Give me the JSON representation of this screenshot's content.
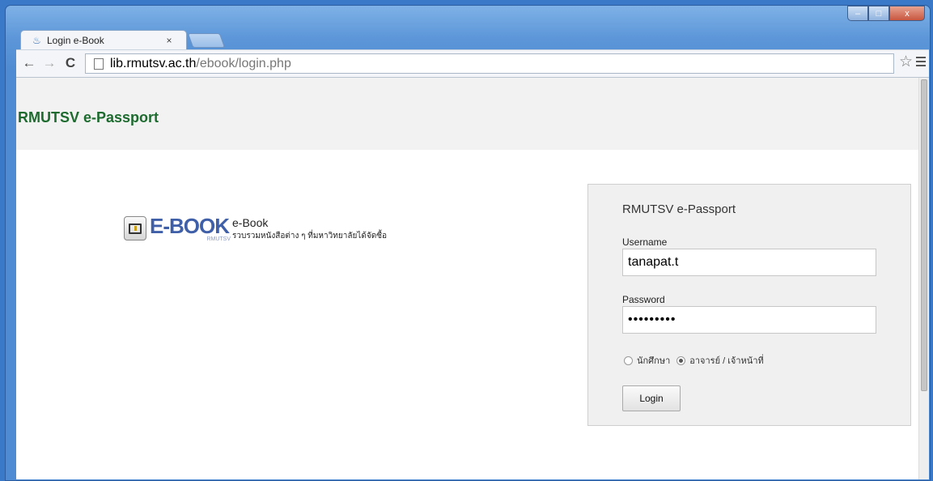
{
  "window": {
    "controls": {
      "minimize": "–",
      "maximize": "□",
      "close": "x"
    }
  },
  "tab": {
    "title": "Login e-Book",
    "close": "×"
  },
  "toolbar": {
    "back": "←",
    "forward": "→",
    "reload": "C",
    "url_host": "lib.rmutsv.ac.th",
    "url_path": "/ebook/login.php",
    "star": "☆"
  },
  "page": {
    "brand": "RMUTSV e-Passport",
    "logo": {
      "word": "E-BOOK",
      "sub": "RMUTSV"
    },
    "ebook": {
      "title": "e-Book",
      "description": "รวบรวมหนังสือต่าง ๆ ที่มหาวิทยาลัยได้จัดซื้อ"
    },
    "login": {
      "title": "RMUTSV e-Passport",
      "username_label": "Username",
      "username_value": "tanapat.t",
      "password_label": "Password",
      "password_value": "•••••••••",
      "role_student": "นักศึกษา",
      "role_staff": "อาจารย์ / เจ้าหน้าที่",
      "selected_role": "staff",
      "button": "Login"
    }
  },
  "colors": {
    "brand_green": "#1d6b2f",
    "logo_blue": "#3f5fa8",
    "window_blue": "#5d97d9"
  }
}
